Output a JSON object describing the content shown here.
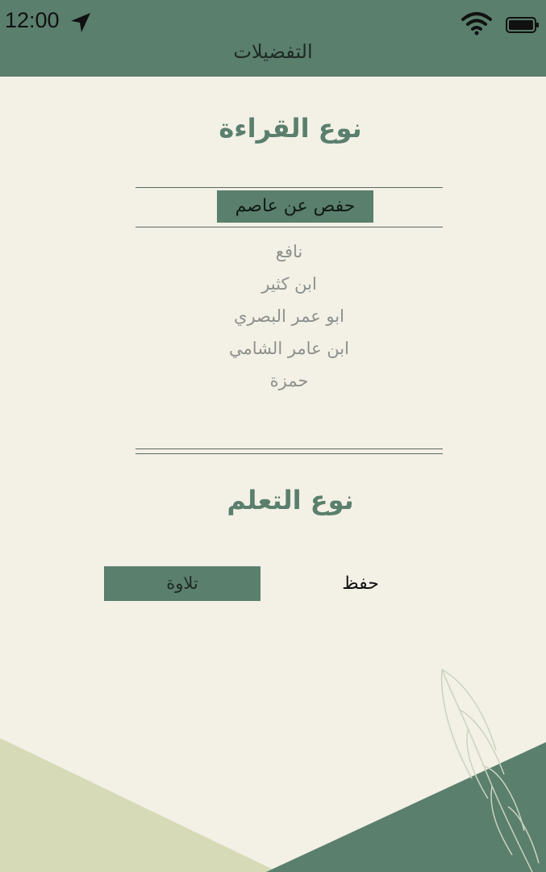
{
  "status_bar": {
    "time": "12:00",
    "icons": [
      "location-arrow-icon",
      "wifi-icon",
      "battery-icon"
    ]
  },
  "nav": {
    "title": "التفضيلات"
  },
  "reading": {
    "title": "نوع القراءة",
    "selected": "حفص عن عاصم",
    "options": [
      "نافع",
      "ابن كثير",
      "ابو عمر البصري",
      "ابن عامر الشامي",
      "حمزة"
    ]
  },
  "learning": {
    "title": "نوع التعلم",
    "active_option": "تلاوة",
    "inactive_option": "حفظ"
  },
  "colors": {
    "primary": "#5a7f6d",
    "background": "#f3f0e6",
    "accent_light": "#d6dab6"
  }
}
